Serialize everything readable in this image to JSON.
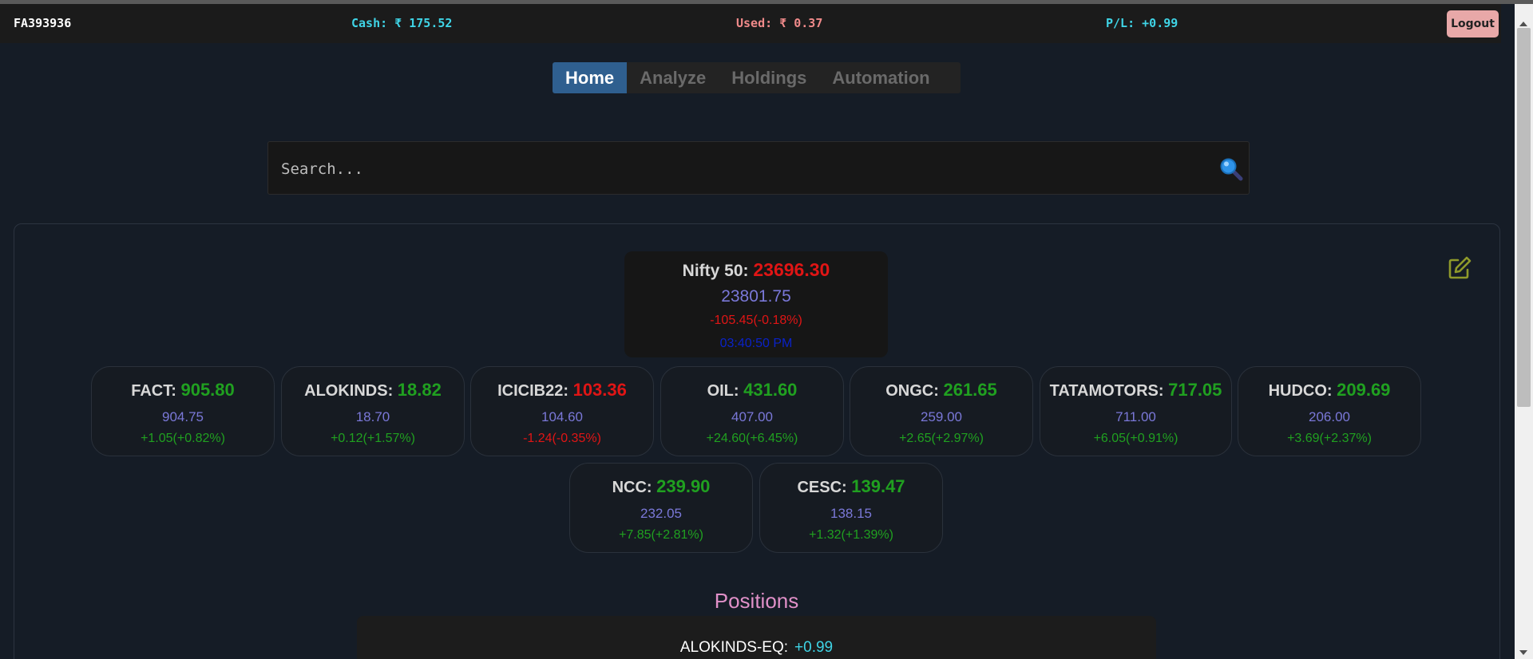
{
  "topbar": {
    "account": "FA393936",
    "cash": "Cash: ₹ 175.52",
    "used": "Used: ₹ 0.37",
    "pl": "P/L: +0.99",
    "logout_label": "Logout"
  },
  "tabs": [
    {
      "label": "Home",
      "active": true
    },
    {
      "label": "Analyze",
      "active": false
    },
    {
      "label": "Holdings",
      "active": false
    },
    {
      "label": "Automation",
      "active": false
    }
  ],
  "search": {
    "placeholder": "Search...",
    "icon": "search-icon"
  },
  "index": {
    "name": "Nifty 50:",
    "value": "23696.30",
    "prev_close": "23801.75",
    "change": "-105.45(-0.18%)",
    "time": "03:40:50 PM",
    "direction": "down"
  },
  "watchlist": [
    {
      "symbol": "FACT:",
      "price": "905.80",
      "prev": "904.75",
      "change": "+1.05(+0.82%)",
      "direction": "up"
    },
    {
      "symbol": "ALOKINDS:",
      "price": "18.82",
      "prev": "18.70",
      "change": "+0.12(+1.57%)",
      "direction": "up"
    },
    {
      "symbol": "ICICIB22:",
      "price": "103.36",
      "prev": "104.60",
      "change": "-1.24(-0.35%)",
      "direction": "down"
    },
    {
      "symbol": "OIL:",
      "price": "431.60",
      "prev": "407.00",
      "change": "+24.60(+6.45%)",
      "direction": "up"
    },
    {
      "symbol": "ONGC:",
      "price": "261.65",
      "prev": "259.00",
      "change": "+2.65(+2.97%)",
      "direction": "up"
    },
    {
      "symbol": "TATAMOTORS:",
      "price": "717.05",
      "prev": "711.00",
      "change": "+6.05(+0.91%)",
      "direction": "up"
    },
    {
      "symbol": "HUDCO:",
      "price": "209.69",
      "prev": "206.00",
      "change": "+3.69(+2.37%)",
      "direction": "up"
    },
    {
      "symbol": "NCC:",
      "price": "239.90",
      "prev": "232.05",
      "change": "+7.85(+2.81%)",
      "direction": "up"
    },
    {
      "symbol": "CESC:",
      "price": "139.47",
      "prev": "138.15",
      "change": "+1.32(+1.39%)",
      "direction": "up"
    }
  ],
  "positions": {
    "title": "Positions",
    "rows": [
      {
        "symbol": "ALOKINDS-EQ:",
        "pl": "+0.99"
      }
    ]
  },
  "colors": {
    "background": "#151c26",
    "up": "#20a020",
    "down": "#e01515",
    "prev_close": "#7a78d8",
    "accent": "#3fd4e6",
    "active_tab": "#2f5f8f"
  }
}
